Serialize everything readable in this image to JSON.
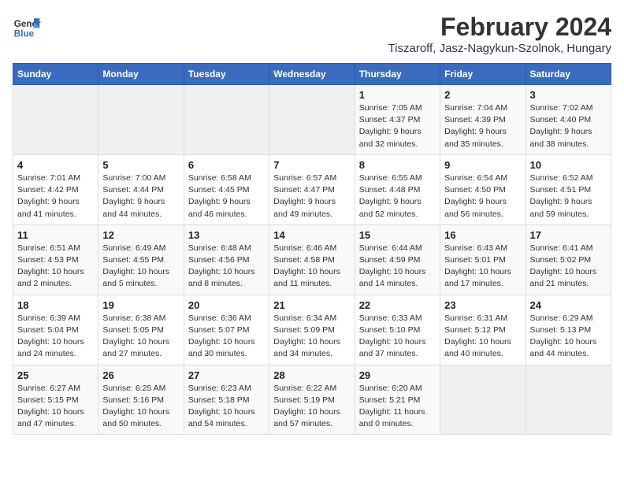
{
  "header": {
    "logo_line1": "General",
    "logo_line2": "Blue",
    "title": "February 2024",
    "subtitle": "Tiszaroff, Jasz-Nagykun-Szolnok, Hungary"
  },
  "weekdays": [
    "Sunday",
    "Monday",
    "Tuesday",
    "Wednesday",
    "Thursday",
    "Friday",
    "Saturday"
  ],
  "weeks": [
    [
      {
        "num": "",
        "info": ""
      },
      {
        "num": "",
        "info": ""
      },
      {
        "num": "",
        "info": ""
      },
      {
        "num": "",
        "info": ""
      },
      {
        "num": "1",
        "info": "Sunrise: 7:05 AM\nSunset: 4:37 PM\nDaylight: 9 hours\nand 32 minutes."
      },
      {
        "num": "2",
        "info": "Sunrise: 7:04 AM\nSunset: 4:39 PM\nDaylight: 9 hours\nand 35 minutes."
      },
      {
        "num": "3",
        "info": "Sunrise: 7:02 AM\nSunset: 4:40 PM\nDaylight: 9 hours\nand 38 minutes."
      }
    ],
    [
      {
        "num": "4",
        "info": "Sunrise: 7:01 AM\nSunset: 4:42 PM\nDaylight: 9 hours\nand 41 minutes."
      },
      {
        "num": "5",
        "info": "Sunrise: 7:00 AM\nSunset: 4:44 PM\nDaylight: 9 hours\nand 44 minutes."
      },
      {
        "num": "6",
        "info": "Sunrise: 6:58 AM\nSunset: 4:45 PM\nDaylight: 9 hours\nand 46 minutes."
      },
      {
        "num": "7",
        "info": "Sunrise: 6:57 AM\nSunset: 4:47 PM\nDaylight: 9 hours\nand 49 minutes."
      },
      {
        "num": "8",
        "info": "Sunrise: 6:55 AM\nSunset: 4:48 PM\nDaylight: 9 hours\nand 52 minutes."
      },
      {
        "num": "9",
        "info": "Sunrise: 6:54 AM\nSunset: 4:50 PM\nDaylight: 9 hours\nand 56 minutes."
      },
      {
        "num": "10",
        "info": "Sunrise: 6:52 AM\nSunset: 4:51 PM\nDaylight: 9 hours\nand 59 minutes."
      }
    ],
    [
      {
        "num": "11",
        "info": "Sunrise: 6:51 AM\nSunset: 4:53 PM\nDaylight: 10 hours\nand 2 minutes."
      },
      {
        "num": "12",
        "info": "Sunrise: 6:49 AM\nSunset: 4:55 PM\nDaylight: 10 hours\nand 5 minutes."
      },
      {
        "num": "13",
        "info": "Sunrise: 6:48 AM\nSunset: 4:56 PM\nDaylight: 10 hours\nand 8 minutes."
      },
      {
        "num": "14",
        "info": "Sunrise: 6:46 AM\nSunset: 4:58 PM\nDaylight: 10 hours\nand 11 minutes."
      },
      {
        "num": "15",
        "info": "Sunrise: 6:44 AM\nSunset: 4:59 PM\nDaylight: 10 hours\nand 14 minutes."
      },
      {
        "num": "16",
        "info": "Sunrise: 6:43 AM\nSunset: 5:01 PM\nDaylight: 10 hours\nand 17 minutes."
      },
      {
        "num": "17",
        "info": "Sunrise: 6:41 AM\nSunset: 5:02 PM\nDaylight: 10 hours\nand 21 minutes."
      }
    ],
    [
      {
        "num": "18",
        "info": "Sunrise: 6:39 AM\nSunset: 5:04 PM\nDaylight: 10 hours\nand 24 minutes."
      },
      {
        "num": "19",
        "info": "Sunrise: 6:38 AM\nSunset: 5:05 PM\nDaylight: 10 hours\nand 27 minutes."
      },
      {
        "num": "20",
        "info": "Sunrise: 6:36 AM\nSunset: 5:07 PM\nDaylight: 10 hours\nand 30 minutes."
      },
      {
        "num": "21",
        "info": "Sunrise: 6:34 AM\nSunset: 5:09 PM\nDaylight: 10 hours\nand 34 minutes."
      },
      {
        "num": "22",
        "info": "Sunrise: 6:33 AM\nSunset: 5:10 PM\nDaylight: 10 hours\nand 37 minutes."
      },
      {
        "num": "23",
        "info": "Sunrise: 6:31 AM\nSunset: 5:12 PM\nDaylight: 10 hours\nand 40 minutes."
      },
      {
        "num": "24",
        "info": "Sunrise: 6:29 AM\nSunset: 5:13 PM\nDaylight: 10 hours\nand 44 minutes."
      }
    ],
    [
      {
        "num": "25",
        "info": "Sunrise: 6:27 AM\nSunset: 5:15 PM\nDaylight: 10 hours\nand 47 minutes."
      },
      {
        "num": "26",
        "info": "Sunrise: 6:25 AM\nSunset: 5:16 PM\nDaylight: 10 hours\nand 50 minutes."
      },
      {
        "num": "27",
        "info": "Sunrise: 6:23 AM\nSunset: 5:18 PM\nDaylight: 10 hours\nand 54 minutes."
      },
      {
        "num": "28",
        "info": "Sunrise: 6:22 AM\nSunset: 5:19 PM\nDaylight: 10 hours\nand 57 minutes."
      },
      {
        "num": "29",
        "info": "Sunrise: 6:20 AM\nSunset: 5:21 PM\nDaylight: 11 hours\nand 0 minutes."
      },
      {
        "num": "",
        "info": ""
      },
      {
        "num": "",
        "info": ""
      }
    ]
  ]
}
